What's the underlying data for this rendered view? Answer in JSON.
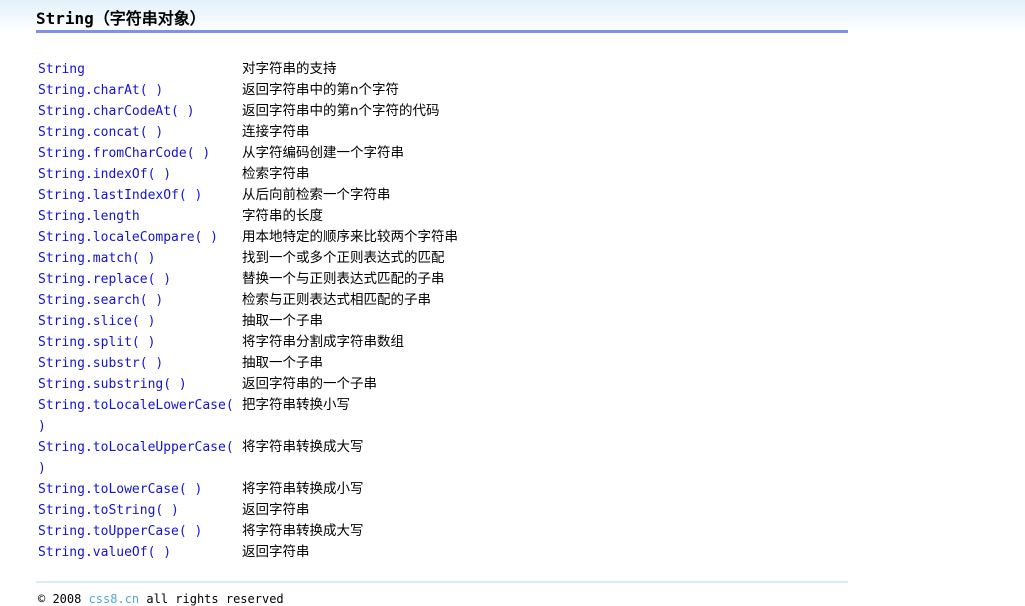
{
  "header": {
    "title": "String（字符串对象）",
    "rule_color": "#8090ee",
    "gradient_top": "#e4f1fb",
    "gradient_bottom": "#ffffff"
  },
  "list": {
    "link_color": "#1414d2",
    "items": [
      {
        "name": "String",
        "desc": "对字符串的支持"
      },
      {
        "name": "String.charAt( )",
        "desc": "返回字符串中的第n个字符"
      },
      {
        "name": "String.charCodeAt( )",
        "desc": "返回字符串中的第n个字符的代码"
      },
      {
        "name": "String.concat( )",
        "desc": "连接字符串"
      },
      {
        "name": "String.fromCharCode( )",
        "desc": "从字符编码创建一个字符串"
      },
      {
        "name": "String.indexOf( )",
        "desc": "检索字符串"
      },
      {
        "name": "String.lastIndexOf( )",
        "desc": "从后向前检索一个字符串"
      },
      {
        "name": "String.length",
        "desc": "字符串的长度"
      },
      {
        "name": "String.localeCompare( )",
        "desc": "用本地特定的顺序来比较两个字符串"
      },
      {
        "name": "String.match( )",
        "desc": "找到一个或多个正则表达式的匹配"
      },
      {
        "name": "String.replace( )",
        "desc": "替换一个与正则表达式匹配的子串"
      },
      {
        "name": "String.search( )",
        "desc": "检索与正则表达式相匹配的子串"
      },
      {
        "name": "String.slice( )",
        "desc": "抽取一个子串"
      },
      {
        "name": "String.split( )",
        "desc": "将字符串分割成字符串数组"
      },
      {
        "name": "String.substr( )",
        "desc": "抽取一个子串"
      },
      {
        "name": "String.substring( )",
        "desc": "返回字符串的一个子串"
      },
      {
        "name": "String.toLocaleLowerCase( )",
        "desc": "把字符串转换小写"
      },
      {
        "name": "String.toLocaleUpperCase( )",
        "desc": "将字符串转换成大写"
      },
      {
        "name": "String.toLowerCase( )",
        "desc": "将字符串转换成小写"
      },
      {
        "name": "String.toString( )",
        "desc": "返回字符串"
      },
      {
        "name": "String.toUpperCase( )",
        "desc": "将字符串转换成大写"
      },
      {
        "name": "String.valueOf( )",
        "desc": "返回字符串"
      }
    ]
  },
  "footer": {
    "copyright_prefix": "© 2008 ",
    "link_label": "css8.cn",
    "copyright_suffix": " all rights reserved",
    "link_color": "#4fa8d8",
    "rule_color": "#d8edf2"
  }
}
